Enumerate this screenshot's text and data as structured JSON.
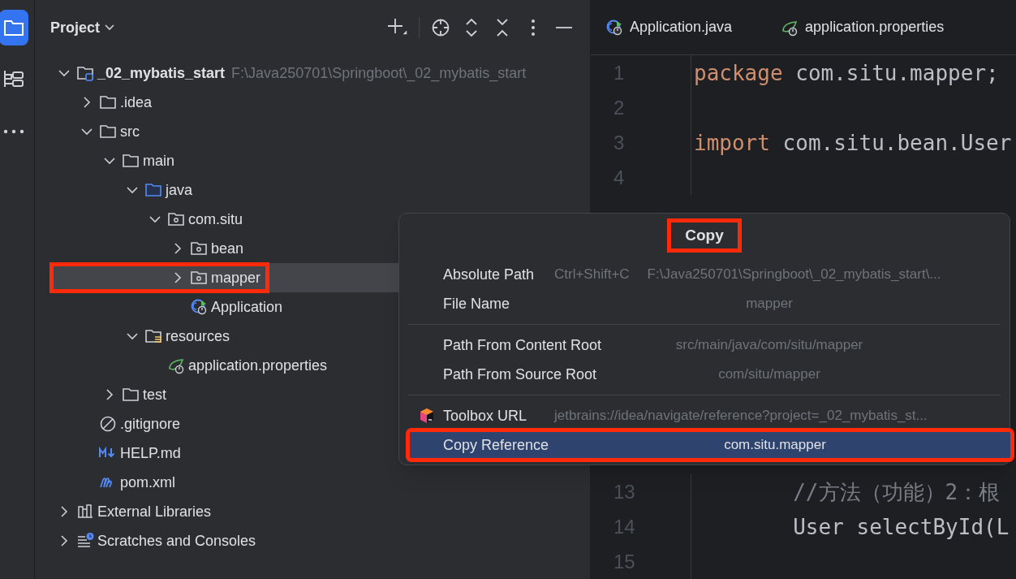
{
  "tool_strip": {
    "items": [
      {
        "kind": "project",
        "selected": true
      },
      {
        "kind": "structure",
        "selected": false
      },
      {
        "kind": "more",
        "selected": false
      }
    ]
  },
  "project_panel": {
    "title": "Project",
    "tree": [
      {
        "label": "_02_mybatis_start",
        "path": "F:\\Java250701\\Springboot\\_02_mybatis_start",
        "kind": "module",
        "expanded": true,
        "selected": false,
        "marked": false,
        "children": [
          {
            "label": ".idea",
            "kind": "folder",
            "expanded": false,
            "selected": false,
            "marked": false
          },
          {
            "label": "src",
            "kind": "folder",
            "expanded": true,
            "selected": false,
            "marked": false,
            "children": [
              {
                "label": "main",
                "kind": "folder",
                "expanded": true,
                "selected": false,
                "marked": false,
                "children": [
                  {
                    "label": "java",
                    "kind": "source-folder",
                    "expanded": true,
                    "selected": false,
                    "marked": false,
                    "children": [
                      {
                        "label": "com.situ",
                        "kind": "package",
                        "expanded": true,
                        "selected": false,
                        "marked": false,
                        "children": [
                          {
                            "label": "bean",
                            "kind": "package",
                            "expanded": false,
                            "selected": false,
                            "marked": false
                          },
                          {
                            "label": "mapper",
                            "kind": "package",
                            "expanded": false,
                            "selected": true,
                            "marked": true
                          },
                          {
                            "label": "Application",
                            "kind": "spring-class",
                            "selected": false,
                            "marked": false
                          }
                        ]
                      }
                    ]
                  },
                  {
                    "label": "resources",
                    "kind": "resource-folder",
                    "expanded": true,
                    "selected": false,
                    "marked": false,
                    "children": [
                      {
                        "label": "application.properties",
                        "kind": "spring-properties",
                        "selected": false,
                        "marked": false
                      }
                    ]
                  }
                ]
              },
              {
                "label": "test",
                "kind": "folder",
                "expanded": false,
                "selected": false,
                "marked": false
              }
            ]
          },
          {
            "label": ".gitignore",
            "kind": "ignore-file",
            "selected": false,
            "marked": false
          },
          {
            "label": "HELP.md",
            "kind": "markdown-file",
            "selected": false,
            "marked": false
          },
          {
            "label": "pom.xml",
            "kind": "maven-file",
            "selected": false,
            "marked": false
          }
        ]
      },
      {
        "label": "External Libraries",
        "kind": "libraries",
        "expanded": false,
        "selected": false,
        "marked": false
      },
      {
        "label": "Scratches and Consoles",
        "kind": "scratches",
        "expanded": false,
        "selected": false,
        "marked": false
      }
    ]
  },
  "editor": {
    "tabs": [
      {
        "label": "Application.java",
        "kind": "spring-class"
      },
      {
        "label": "application.properties",
        "kind": "spring-properties"
      }
    ],
    "lines": [
      {
        "number": "1",
        "tokens": [
          {
            "kind": "keyword",
            "text": "package"
          },
          {
            "kind": "plain",
            "text": " com.situ.mapper;"
          }
        ]
      },
      {
        "number": "2"
      },
      {
        "number": "3",
        "tokens": [
          {
            "kind": "keyword",
            "text": "import"
          },
          {
            "kind": "plain",
            "text": " com.situ.bean.User"
          }
        ]
      },
      {
        "number": "4"
      },
      {
        "number": "13",
        "indented": true,
        "tokens": [
          {
            "kind": "comment",
            "text": "//方法（功能）2：根"
          }
        ]
      },
      {
        "number": "14",
        "indented": true,
        "tokens": [
          {
            "kind": "plain",
            "text": "User "
          },
          {
            "kind": "method",
            "text": "selectById"
          },
          {
            "kind": "plain",
            "text": "(L"
          }
        ]
      },
      {
        "number": "15"
      }
    ]
  },
  "copy_popup": {
    "title": "Copy",
    "title_marked": true,
    "groups": [
      [
        {
          "kind": "plain",
          "label": "Absolute Path",
          "shortcut": "Ctrl+Shift+C",
          "value": "F:\\Java250701\\Springboot\\_02_mybatis_start\\...",
          "selected": false,
          "marked": false
        },
        {
          "kind": "plain",
          "label": "File Name",
          "value": "mapper",
          "selected": false,
          "marked": false
        }
      ],
      [
        {
          "kind": "plain",
          "label": "Path From Content Root",
          "value": "src/main/java/com/situ/mapper",
          "selected": false,
          "marked": false
        },
        {
          "kind": "plain",
          "label": "Path From Source Root",
          "value": "com/situ/mapper",
          "selected": false,
          "marked": false
        }
      ],
      [
        {
          "kind": "toolbox",
          "label": "Toolbox URL",
          "value": "jetbrains://idea/navigate/reference?project=_02_mybatis_st...",
          "selected": false,
          "marked": false
        },
        {
          "kind": "plain",
          "label": "Copy Reference",
          "value": "com.situ.mapper",
          "selected": true,
          "marked": true
        }
      ]
    ]
  }
}
